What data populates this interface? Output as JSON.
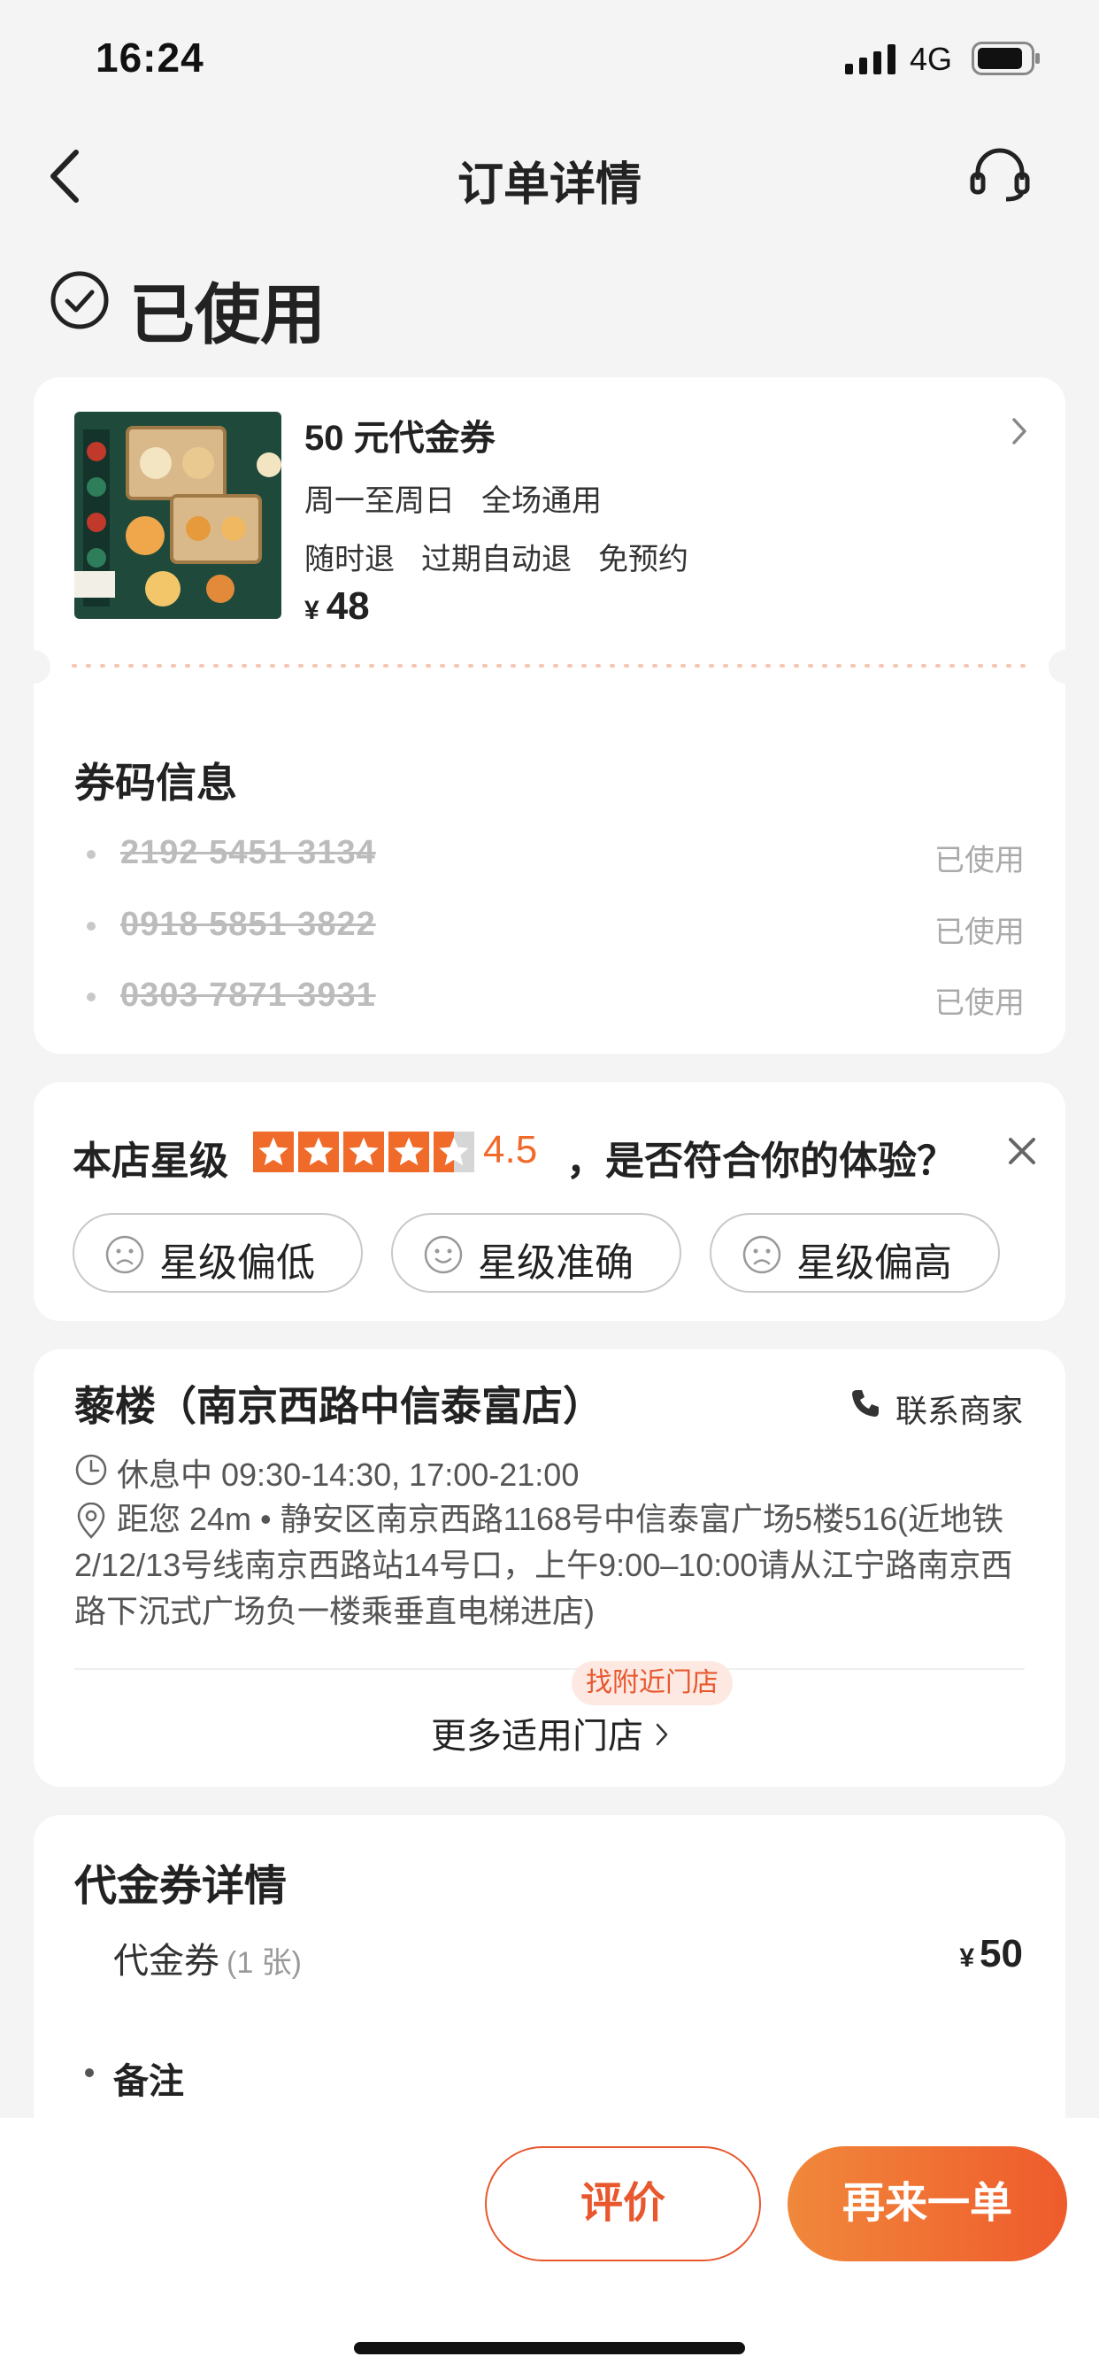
{
  "status_bar": {
    "time": "16:24",
    "network": "4G",
    "icons": [
      "signal-icon",
      "battery-icon"
    ]
  },
  "nav": {
    "title": "订单详情",
    "icons": [
      "back-icon",
      "customer-service-icon"
    ]
  },
  "order_status": {
    "label": "已使用",
    "icon": "check-circle-icon"
  },
  "product": {
    "title": "50 元代金券",
    "tags_line1": [
      "周一至周日",
      "全场通用"
    ],
    "tags_line2": [
      "随时退",
      "过期自动退",
      "免预约"
    ],
    "currency": "¥",
    "price": "48"
  },
  "coupon_codes": {
    "title": "券码信息",
    "items": [
      {
        "code": "2192 5451 3134",
        "status": "已使用"
      },
      {
        "code": "0918 5851 3822",
        "status": "已使用"
      },
      {
        "code": "0303 7871 3931",
        "status": "已使用"
      }
    ]
  },
  "rating": {
    "label": "本店星级",
    "score": "4.5",
    "score_value": 4.5,
    "max": 5,
    "question": "，是否符合你的体验？",
    "options": [
      {
        "label": "星级偏低",
        "icon": "sad-face-icon"
      },
      {
        "label": "星级准确",
        "icon": "smile-face-icon"
      },
      {
        "label": "星级偏高",
        "icon": "sad-face-icon"
      }
    ],
    "star_color": "#f06a2a"
  },
  "shop": {
    "name": "藜楼（南京西路中信泰富店）",
    "contact_label": "联系商家",
    "hours": "休息中 09:30-14:30, 17:00-21:00",
    "address": "距您 24m • 静安区南京西路1168号中信泰富广场5楼516(近地铁2/12/13号线南京西路站14号口，上午9:00–10:00请从江宁路南京西路下沉式广场负一楼乘垂直电梯进店)",
    "nearby_badge": "找附近门店",
    "more_stores": "更多适用门店"
  },
  "voucher_detail": {
    "title": "代金券详情",
    "item_name": "代金券",
    "item_count": "(1 张)",
    "currency": "¥",
    "amount": "50",
    "note_label": "备注"
  },
  "actions": {
    "review": "评价",
    "reorder": "再来一单"
  },
  "colors": {
    "accent": "#ef5b2c",
    "background": "#f4f4f4"
  }
}
